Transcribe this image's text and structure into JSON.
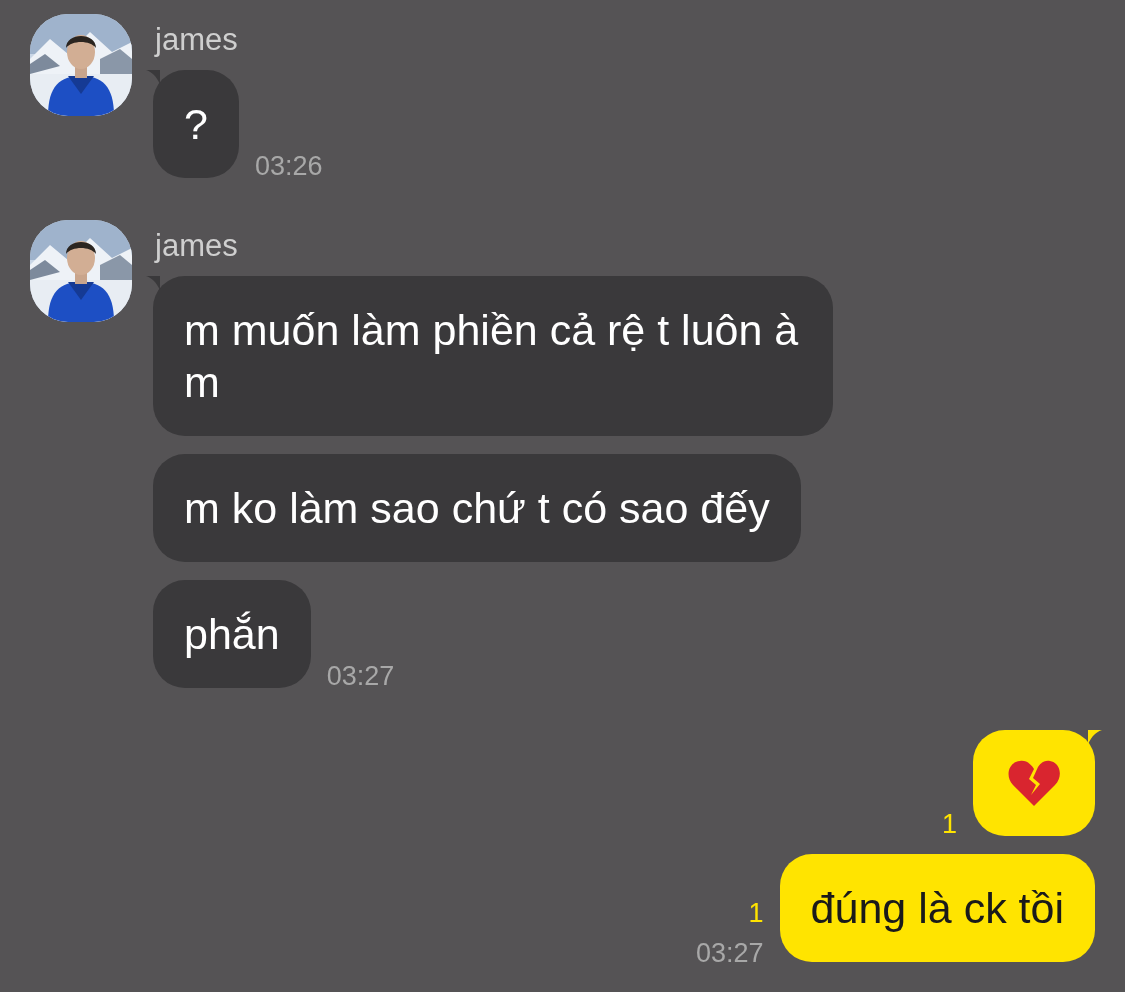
{
  "messages": [
    {
      "kind": "incoming",
      "sender": "james",
      "time": "03:26",
      "bubbles": [
        {
          "kind": "text",
          "text": "?"
        }
      ]
    },
    {
      "kind": "incoming",
      "sender": "james",
      "time": "03:27",
      "bubbles": [
        {
          "kind": "text",
          "text": "m muốn làm phiền cả rệ t luôn à m"
        },
        {
          "kind": "text",
          "text": "m ko làm sao chứ t có sao đếy"
        },
        {
          "kind": "text",
          "text": "phắn"
        }
      ]
    },
    {
      "kind": "outgoing",
      "time": "03:27",
      "bubbles": [
        {
          "kind": "broken-heart",
          "unread": "1"
        },
        {
          "kind": "text",
          "text": "đúng là ck tồi",
          "unread": "1"
        }
      ]
    }
  ]
}
